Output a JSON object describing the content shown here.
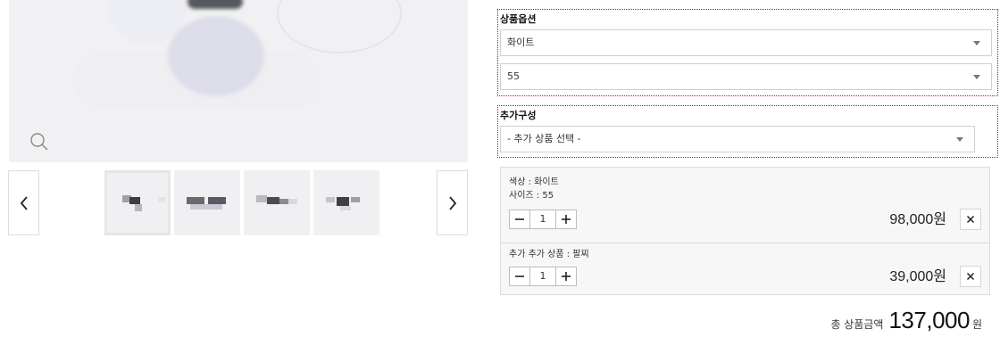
{
  "product_image": {
    "zoom_icon": "zoom-icon"
  },
  "thumbnails": {
    "prev_icon": "chevron-left-icon",
    "next_icon": "chevron-right-icon",
    "count": 4,
    "active_index": 0
  },
  "options": {
    "title": "상품옵션",
    "color_select": {
      "value": "화이트"
    },
    "size_select": {
      "value": "55"
    }
  },
  "additional": {
    "title": "추가구성",
    "select": {
      "value": "- 추가 상품 선택 -"
    }
  },
  "selected_items": [
    {
      "line1": "색상 : 화이트",
      "line2": "사이즈 : 55",
      "quantity": "1",
      "price": "98,000원"
    },
    {
      "line1": "추가 추가 상품 : 팔찌",
      "quantity": "1",
      "price": "39,000원"
    }
  ],
  "total": {
    "label": "총 상품금액",
    "amount": "137,000",
    "unit": "원"
  },
  "colors": {
    "highlight_border": "#b3161b",
    "panel_bg": "#f7f7f7"
  }
}
